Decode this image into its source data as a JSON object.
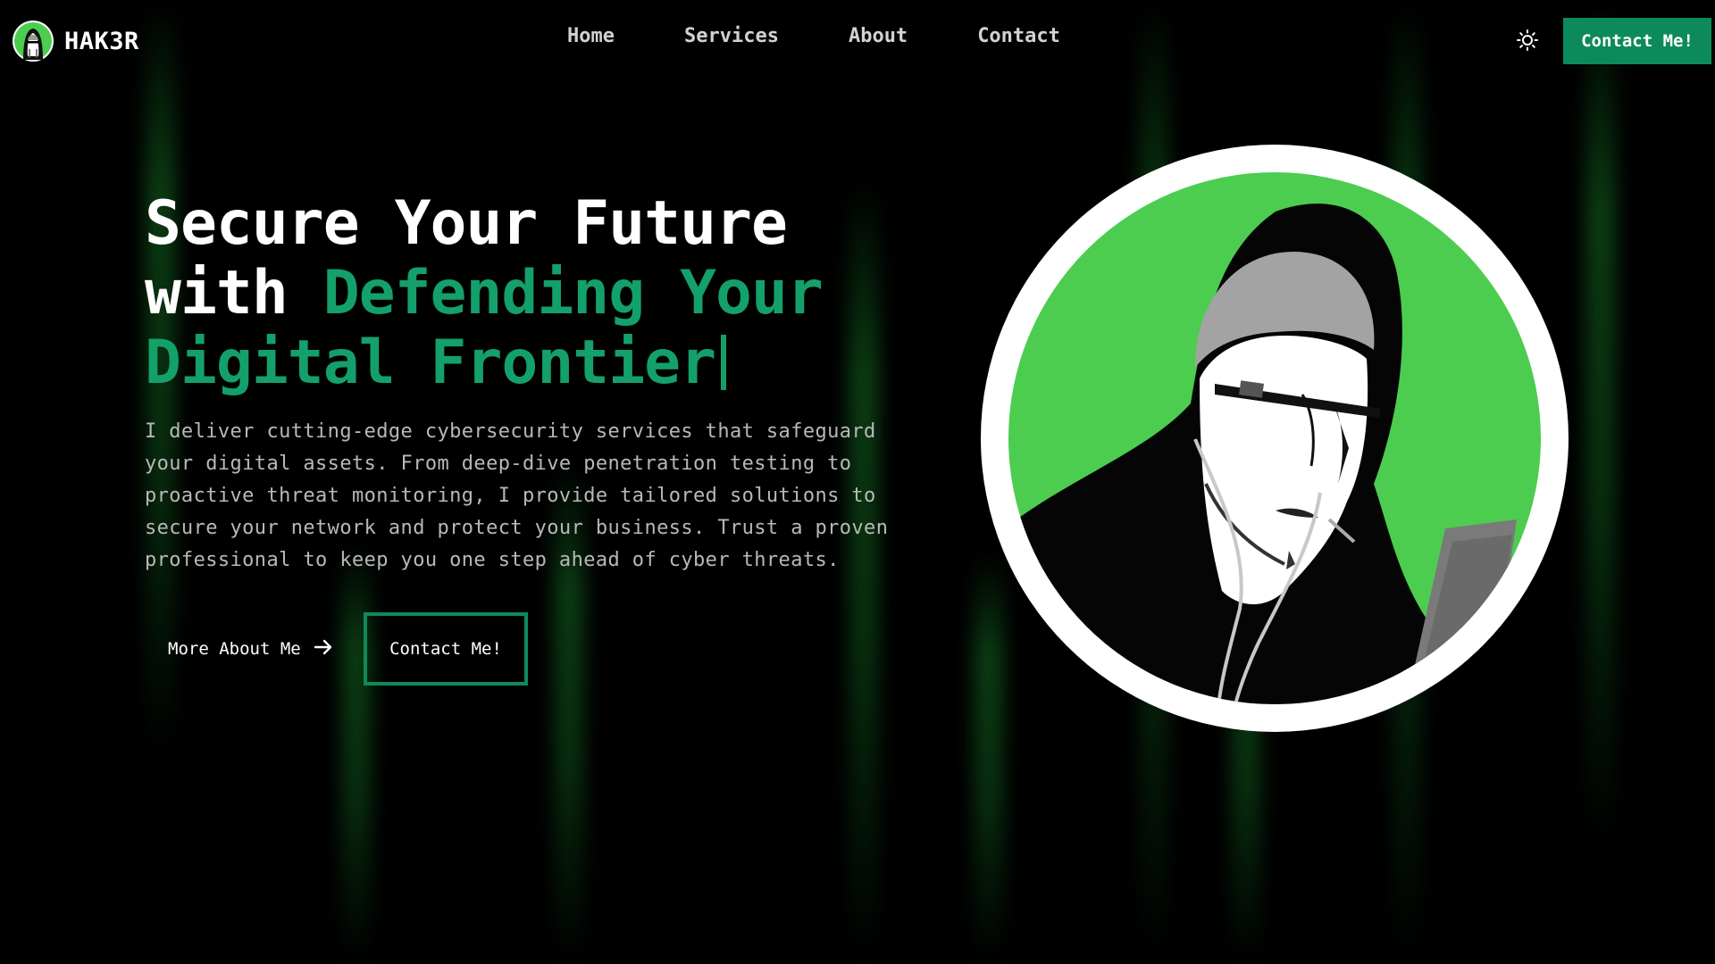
{
  "header": {
    "brand": "HAK3R",
    "nav": [
      "Home",
      "Services",
      "About",
      "Contact"
    ],
    "cta_label": "Contact Me!"
  },
  "hero": {
    "title_white": "Secure Your Future with",
    "title_accent": "Defending Your Digital Frontier",
    "description": "I deliver cutting-edge cybersecurity services that safeguard your digital assets. From deep-dive penetration testing to proactive threat monitoring, I provide tailored solutions to secure your network and protect your business. Trust a proven professional to keep you one step ahead of cyber threats.",
    "more_label": "More About Me",
    "contact_label": "Contact Me!"
  },
  "icons": {
    "logo": "hacker-avatar-icon",
    "theme_toggle": "sun-icon",
    "more_arrow": "arrow-right-icon",
    "portrait": "hooded-hacker-illustration"
  },
  "colors": {
    "background": "#000000",
    "accent": "#14a06b",
    "button": "#0d8a5c",
    "portrait_green": "#4ccd50",
    "streak": "#146e23"
  }
}
